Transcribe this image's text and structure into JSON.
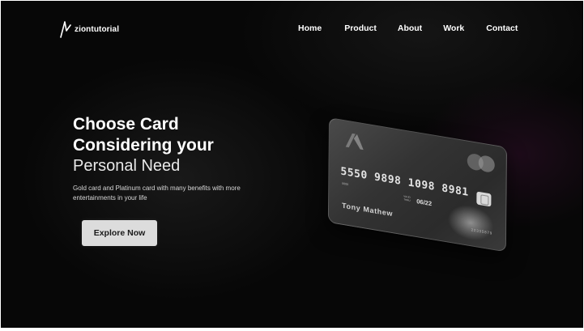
{
  "brand": {
    "name": "ziontutorial",
    "icon": "zigzag-logo-icon"
  },
  "nav": {
    "items": [
      "Home",
      "Product",
      "About",
      "Work",
      "Contact"
    ]
  },
  "hero": {
    "heading_line1": "Choose Card",
    "heading_line2": "Considering your",
    "heading_line3": "Personal Need",
    "description": "Gold card and Platinum card with many benefits with more entertainments in your life",
    "cta_label": "Explore Now"
  },
  "card": {
    "logo_icon": "card-brand-logo-icon",
    "network_icon": "two-circles-network-icon",
    "number": "5550 9898 1098 8981",
    "small_label": "0000",
    "valid_label": "VALID THRU",
    "expiry": "06/22",
    "holder": "Tony Mathew",
    "code": "22335879",
    "chip_icon": "chip-icon"
  },
  "colors": {
    "background": "#070707",
    "text": "#ffffff",
    "button_bg": "#dcdcdc",
    "button_text": "#1a1a1a"
  }
}
